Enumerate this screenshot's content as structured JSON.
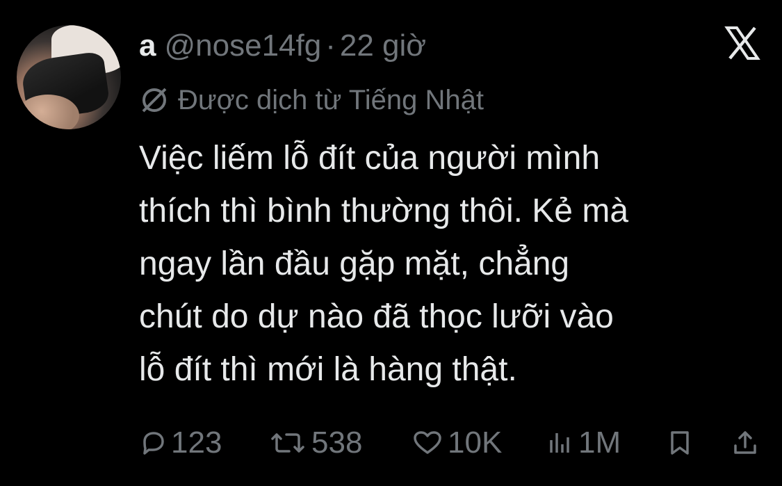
{
  "tweet": {
    "display_name": "a",
    "handle": "@nose14fg",
    "separator": "·",
    "time": "22 giờ",
    "translated_label": "Được dịch từ Tiếng Nhật",
    "body_lines": [
      "Việc liếm lỗ đít của người mình",
      "thích thì bình thường thôi. Kẻ mà",
      "ngay lần đầu gặp mặt, chẳng",
      "chút do dự nào đã thọc lưỡi vào",
      "lỗ đít thì mới là hàng thật."
    ]
  },
  "actions": {
    "replies": "123",
    "reposts": "538",
    "likes": "10K",
    "views": "1M"
  },
  "icons": {
    "logo": "x-logo-icon",
    "translate": "globe-slash-icon",
    "reply": "reply-icon",
    "repost": "repost-icon",
    "like": "heart-icon",
    "views": "bar-chart-icon",
    "bookmark": "bookmark-icon",
    "share": "share-icon"
  },
  "colors": {
    "background": "#000000",
    "text": "#e7e9ea",
    "muted": "#71767b"
  }
}
